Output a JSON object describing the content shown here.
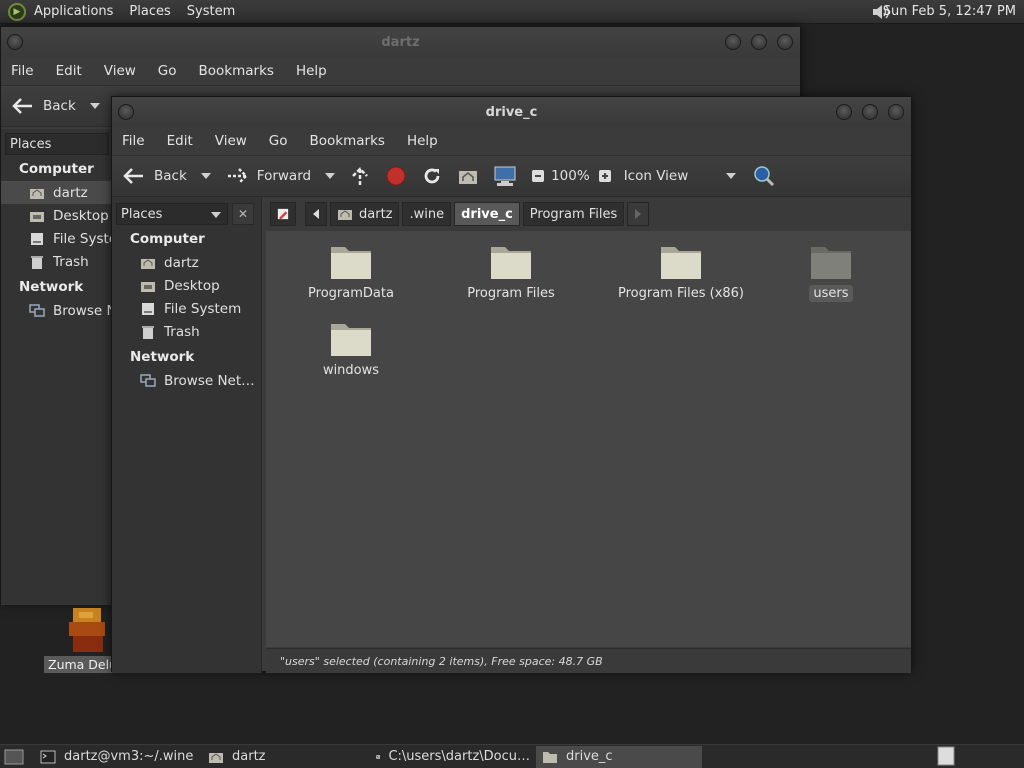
{
  "top_panel": {
    "menus": [
      "Applications",
      "Places",
      "System"
    ],
    "clock": "Sun Feb  5, 12:47 PM"
  },
  "back_window": {
    "title": "dartz",
    "menu": [
      "File",
      "Edit",
      "View",
      "Go",
      "Bookmarks",
      "Help"
    ],
    "toolbar": {
      "back": "Back"
    },
    "places_label": "Places",
    "sidebar": {
      "computer": "Computer",
      "items": [
        "dartz",
        "Desktop",
        "File System",
        "Trash"
      ],
      "network": "Network",
      "net_items": [
        "Browse Network"
      ]
    }
  },
  "front_window": {
    "title": "drive_c",
    "menu": [
      "File",
      "Edit",
      "View",
      "Go",
      "Bookmarks",
      "Help"
    ],
    "toolbar": {
      "back": "Back",
      "forward": "Forward",
      "zoom": "100%",
      "view_mode": "Icon View"
    },
    "places_label": "Places",
    "sidebar": {
      "computer": "Computer",
      "items": [
        "dartz",
        "Desktop",
        "File System",
        "Trash"
      ],
      "network": "Network",
      "net_items": [
        "Browse Net…"
      ]
    },
    "breadcrumbs": [
      "dartz",
      ".wine",
      "drive_c",
      "Program Files"
    ],
    "folders": [
      "ProgramData",
      "Program Files",
      "Program Files (x86)",
      "users",
      "windows"
    ],
    "status": "\"users\" selected (containing 2 items), Free space: 48.7 GB"
  },
  "desktop": {
    "icon_label": "Zuma Deluxe"
  },
  "taskbar": {
    "tasks": [
      "dartz@vm3:~/.wine",
      "dartz",
      "C:\\users\\dartz\\Docu…",
      "drive_c"
    ]
  },
  "colors": {
    "accent_folder": "#d8d6c6",
    "selected_bg": "#5a5a5a"
  }
}
